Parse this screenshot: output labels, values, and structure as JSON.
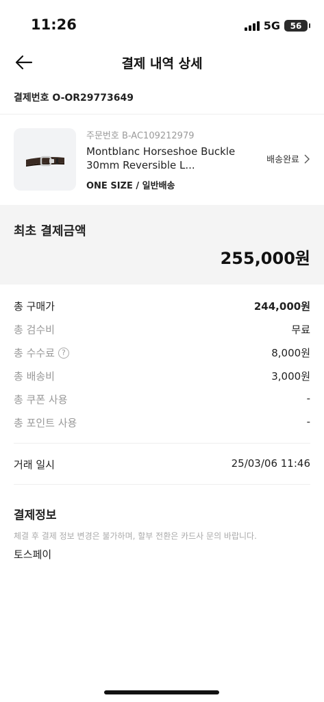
{
  "status_bar": {
    "time": "11:26",
    "network": "5G",
    "battery": "56"
  },
  "nav": {
    "title": "결제 내역 상세"
  },
  "order": {
    "label": "결제번호",
    "number": "O-OR29773649"
  },
  "product": {
    "code_label": "주문번호",
    "code": "B-AC109212979",
    "name": "Montblanc Horseshoe Buckle 30mm Reversible L...",
    "option": "ONE SIZE / 일반배송",
    "status": "배송완료"
  },
  "summary": {
    "label": "최초 결제금액",
    "amount": "255,000원"
  },
  "rows": [
    {
      "label": "총 구매가",
      "value": "244,000원"
    },
    {
      "label": "총 검수비",
      "value": "무료"
    },
    {
      "label": "총 수수료",
      "value": "8,000원"
    },
    {
      "label": "총 배송비",
      "value": "3,000원"
    },
    {
      "label": "총 쿠폰 사용",
      "value": "-"
    },
    {
      "label": "총 포인트 사용",
      "value": "-"
    }
  ],
  "trade": {
    "label": "거래 일시",
    "value": "25/03/06 11:46"
  },
  "payment": {
    "title": "결제정보",
    "note": "체결 후 결제 정보 변경은 불가하며, 할부 전환은 카드사 문의 바랍니다.",
    "method": "토스페이"
  },
  "colors": {
    "accent": "#111111",
    "muted": "#9a9a9a",
    "summary_bg": "#f4f4f4"
  }
}
